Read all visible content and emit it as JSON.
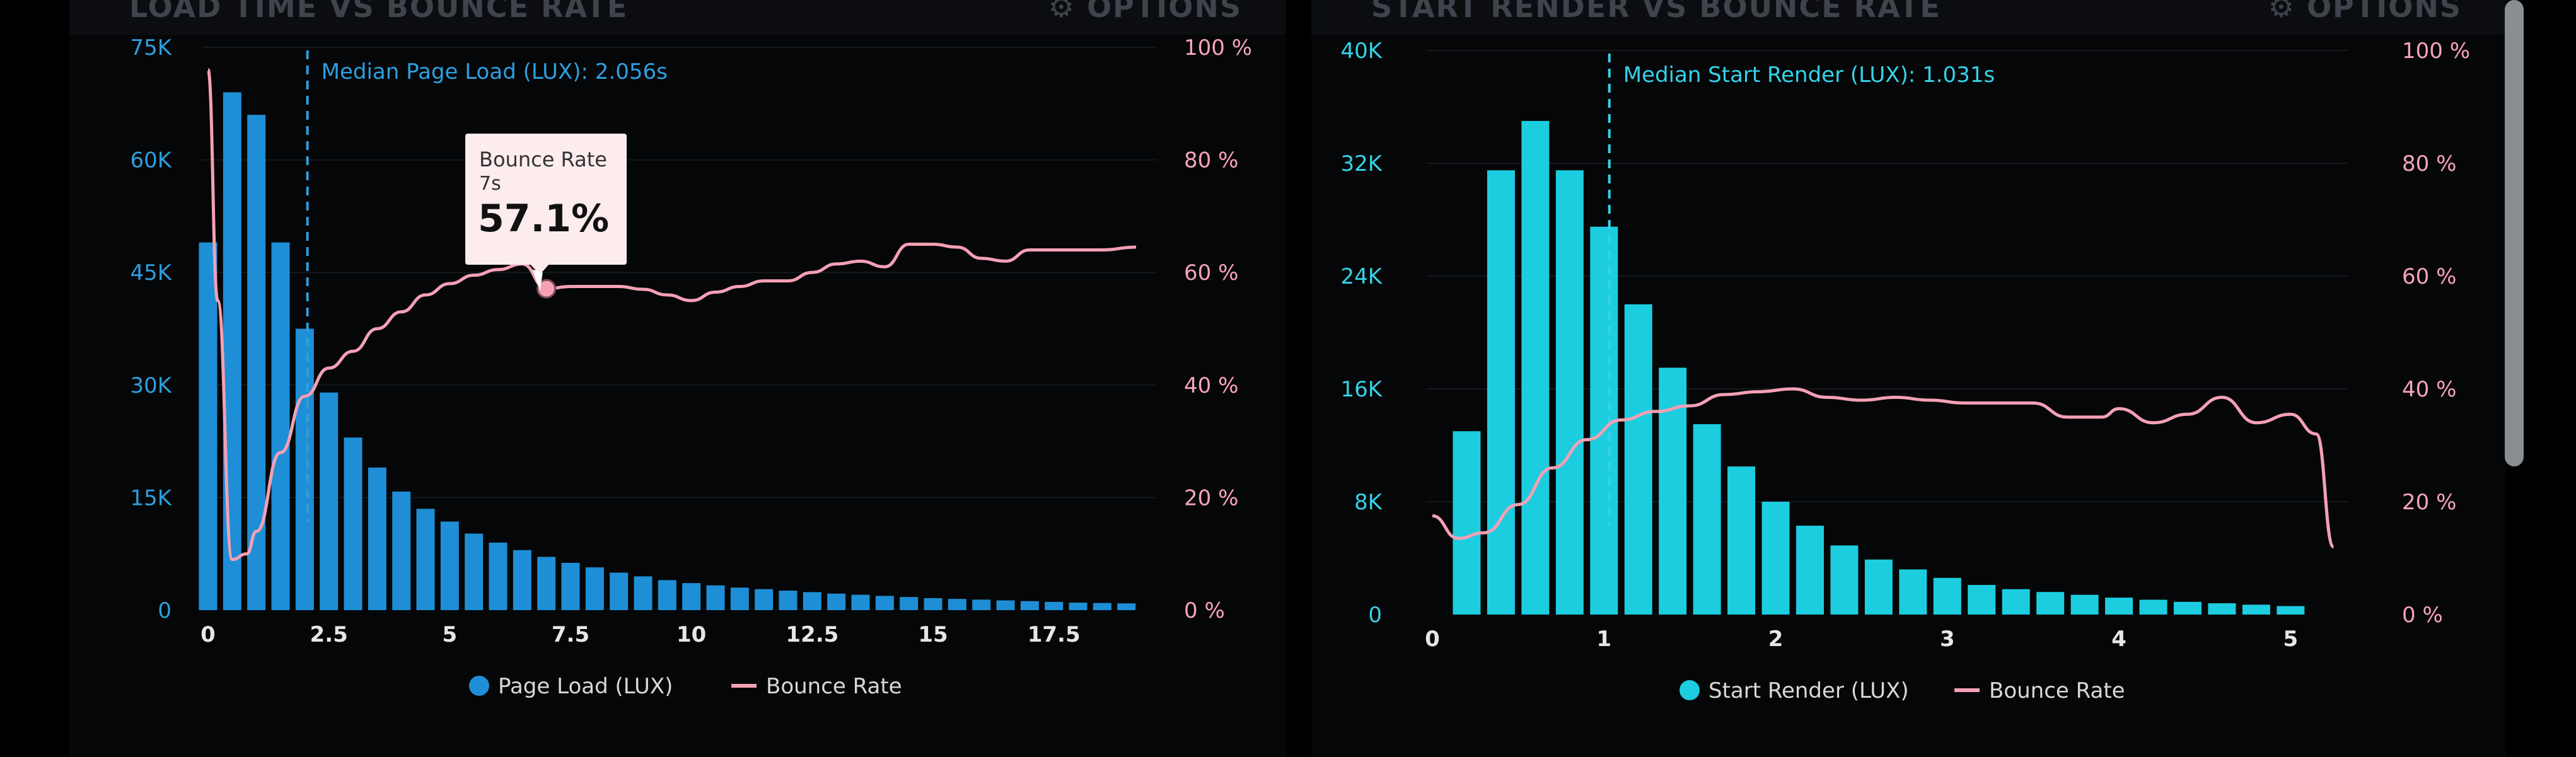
{
  "panels": {
    "left": {
      "title": "LOAD TIME VS BOUNCE RATE",
      "options_label": "⚙ OPTIONS"
    },
    "right": {
      "title": "START RENDER VS BOUNCE RATE",
      "options_label": "⚙ OPTIONS"
    }
  },
  "tooltip": {
    "title": "Bounce Rate",
    "sub": "7s",
    "value": "57.1%"
  },
  "colors": {
    "left_bars": "#1e8fd6",
    "right_bars": "#1ccde0",
    "bounce_line": "#f4a0b5",
    "left_axis": "#2e9fe0",
    "right_axis": "#35d2e8",
    "pink_axis": "#f7a3b8"
  },
  "chart_data": [
    {
      "type": "bar",
      "xlabel": "",
      "ylabel": "",
      "xlim": [
        0,
        19.5
      ],
      "xticks": [
        "0",
        "2.5",
        "5",
        "7.5",
        "10",
        "12.5",
        "15",
        "17.5"
      ],
      "xtick_values": [
        0,
        2.5,
        5,
        7.5,
        10,
        12.5,
        15,
        17.5
      ],
      "ylim": [
        0,
        75000
      ],
      "yticks": [
        "0",
        "15K",
        "30K",
        "45K",
        "60K",
        "75K"
      ],
      "y2lim": [
        0,
        100
      ],
      "y2ticks": [
        "0 %",
        "20 %",
        "40 %",
        "60 %",
        "80 %",
        "100 %"
      ],
      "median_label": "Median Page Load (LUX): 2.056s",
      "median_x": 2.056,
      "legend": [
        "Page Load (LUX)",
        "Bounce Rate"
      ],
      "series": [
        {
          "name": "Page Load (LUX)",
          "x": [
            0,
            0.5,
            1,
            1.5,
            2,
            2.5,
            3,
            3.5,
            4,
            4.5,
            5,
            5.5,
            6,
            6.5,
            7,
            7.5,
            8,
            8.5,
            9,
            9.5,
            10,
            10.5,
            11,
            11.5,
            12,
            12.5,
            13,
            13.5,
            14,
            14.5,
            15,
            15.5,
            16,
            16.5,
            17,
            17.5,
            18,
            18.5,
            19
          ],
          "values": [
            49000,
            69000,
            66000,
            49000,
            37500,
            29000,
            23000,
            19000,
            15800,
            13500,
            11800,
            10200,
            9000,
            8000,
            7100,
            6300,
            5700,
            5000,
            4500,
            4000,
            3600,
            3300,
            3000,
            2800,
            2600,
            2400,
            2200,
            2050,
            1900,
            1750,
            1600,
            1500,
            1400,
            1300,
            1200,
            1100,
            1000,
            950,
            900
          ]
        },
        {
          "name": "Bounce Rate",
          "x": [
            0,
            0.2,
            0.5,
            0.8,
            1,
            1.5,
            2,
            2.5,
            3,
            3.5,
            4,
            4.5,
            5,
            5.5,
            6,
            6.5,
            7,
            7.5,
            8,
            8.5,
            9,
            9.5,
            10,
            10.5,
            11,
            11.5,
            12,
            12.5,
            13,
            13.5,
            14,
            14.5,
            15,
            15.5,
            16,
            16.5,
            17,
            17.5,
            18,
            18.5,
            19.2
          ],
          "values": [
            96,
            55,
            9,
            10,
            14,
            28,
            38,
            43,
            46,
            50,
            53,
            56,
            58,
            59.5,
            60.5,
            61.5,
            57.1,
            57.5,
            57.5,
            57.5,
            57,
            56,
            55,
            56.5,
            57.5,
            58.5,
            58.5,
            60,
            61.5,
            62,
            61,
            65,
            65,
            64.5,
            62.5,
            62,
            64,
            64,
            64,
            64,
            64.5
          ]
        }
      ]
    },
    {
      "type": "bar",
      "xlabel": "",
      "ylabel": "",
      "xlim": [
        0,
        5.3
      ],
      "xticks": [
        "0",
        "1",
        "2",
        "3",
        "4",
        "5"
      ],
      "xtick_values": [
        0,
        1,
        2,
        3,
        4,
        5
      ],
      "ylim": [
        0,
        40000
      ],
      "yticks": [
        "0",
        "8K",
        "16K",
        "24K",
        "32K",
        "40K"
      ],
      "y2lim": [
        0,
        100
      ],
      "y2ticks": [
        "0 %",
        "20 %",
        "40 %",
        "60 %",
        "80 %",
        "100 %"
      ],
      "median_label": "Median Start Render (LUX): 1.031s",
      "median_x": 1.031,
      "legend": [
        "Start Render (LUX)",
        "Bounce Rate"
      ],
      "series": [
        {
          "name": "Start Render (LUX)",
          "x": [
            0.2,
            0.4,
            0.6,
            0.8,
            1,
            1.2,
            1.4,
            1.6,
            1.8,
            2,
            2.2,
            2.4,
            2.6,
            2.8,
            3,
            3.2,
            3.4,
            3.6,
            3.8,
            4,
            4.2,
            4.4,
            4.6,
            4.8,
            5
          ],
          "values": [
            13000,
            31500,
            35000,
            31500,
            27500,
            22000,
            17500,
            13500,
            10500,
            8000,
            6300,
            4900,
            3900,
            3200,
            2600,
            2100,
            1800,
            1600,
            1400,
            1200,
            1050,
            900,
            800,
            700,
            600
          ]
        },
        {
          "name": "Bounce Rate",
          "x": [
            0,
            0.15,
            0.3,
            0.5,
            0.7,
            0.9,
            1.1,
            1.3,
            1.5,
            1.7,
            1.9,
            2.1,
            2.3,
            2.5,
            2.7,
            2.9,
            3.1,
            3.3,
            3.5,
            3.7,
            3.9,
            4.0,
            4.2,
            4.4,
            4.6,
            4.8,
            5.0,
            5.15,
            5.25
          ],
          "values": [
            17.5,
            13.5,
            14.5,
            19.5,
            26,
            31,
            34.5,
            36,
            37,
            39,
            39.5,
            40,
            38.5,
            38,
            38.5,
            38,
            37.5,
            37.5,
            37.5,
            35,
            35,
            36.5,
            34,
            35.5,
            38.5,
            34,
            35.5,
            32,
            12
          ]
        }
      ]
    }
  ]
}
